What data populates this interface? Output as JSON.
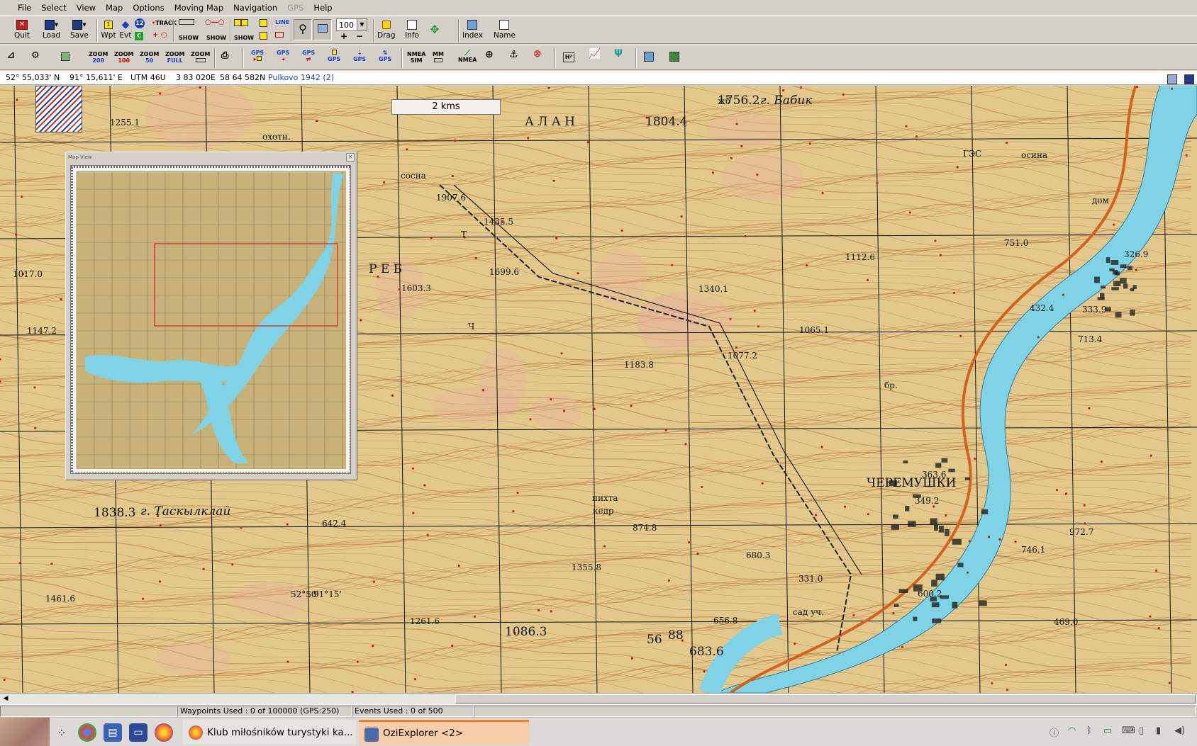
{
  "menu": {
    "items": [
      "File",
      "Select",
      "View",
      "Map",
      "Options",
      "Moving Map",
      "Navigation",
      "GPS",
      "Help"
    ]
  },
  "toolbar1": {
    "quit": "Quit",
    "load": "Load",
    "save": "Save",
    "wpt": "Wpt",
    "evt": "Evt",
    "track": "TRACK",
    "show": "SHOW",
    "show2": "SHOW",
    "show3": "SHOW",
    "line": "LINE",
    "zoom_value": "100",
    "drag": "Drag",
    "info": "Info",
    "index": "Index",
    "name": "Name"
  },
  "toolbar2": {
    "zoom_labels": [
      [
        "ZOOM",
        "200"
      ],
      [
        "ZOOM",
        "100"
      ],
      [
        "ZOOM",
        "50"
      ],
      [
        "ZOOM",
        "FULL"
      ],
      [
        "ZOOM",
        ""
      ]
    ],
    "gps_labels": [
      "GPS",
      "GPS",
      "GPS",
      "GPS",
      "GPS",
      "GPS"
    ],
    "nmea_sim": [
      "NMEA",
      "SIM"
    ],
    "mm": "MM",
    "nmea": "NMEA",
    "h2": "H²"
  },
  "coords": {
    "lat": "52° 55,033' N",
    "lon": "91° 15,611' E",
    "utm": "UTM  46U",
    "easting": "3 83 020E",
    "northing": "58 64 582N",
    "datum": "Pulkovo 1942 (2)"
  },
  "map": {
    "scale_label": "2 kms",
    "labels": [
      "1756.2",
      "г. Бабик",
      "1804.4",
      "1255.1",
      "охотн.",
      "1907.6",
      "1435.5",
      "1699.6",
      "1603.3",
      "1017.0",
      "1147.2",
      "1340.1",
      "1112.6",
      "1183.8",
      "1077.2",
      "1065.1",
      "751.0",
      "326.9",
      "333.9",
      "432.4",
      "713.4",
      "ЧЕРЕМУШКИ",
      "1838.3",
      "г. Таскылклай",
      "642.4",
      "874.8",
      "1355.8",
      "52°50'",
      "91°15'",
      "1461.6",
      "1261.6",
      "1086.3",
      "56",
      "88",
      "683.6",
      "656.8",
      "600.2",
      "972.7",
      "746.1",
      "469.0",
      "680.3",
      "331.0",
      "349.2",
      "363.6",
      "А Л А Н",
      "Р Е Б",
      "Т",
      "Ч",
      "пихта",
      "кедр",
      "сосна",
      "осина",
      "дом",
      "бр.",
      "сад уч.",
      "ГЭС",
      "жб"
    ],
    "mapview_title": "Map View"
  },
  "status": {
    "waypoints": "Waypoints Used : 0 of 100000  (GPS:250)",
    "events": "Events Used : 0 of 500"
  },
  "taskbar": {
    "items": [
      "Klub miłośników turystyki ka...",
      "OziExplorer <2>"
    ]
  },
  "colors": {
    "map_base": "#e2c98b",
    "contour": "#b5773a",
    "water": "#7ed3e6",
    "grid": "#111111",
    "road": "#d2621e",
    "ui_bg": "#d4d0c8"
  }
}
